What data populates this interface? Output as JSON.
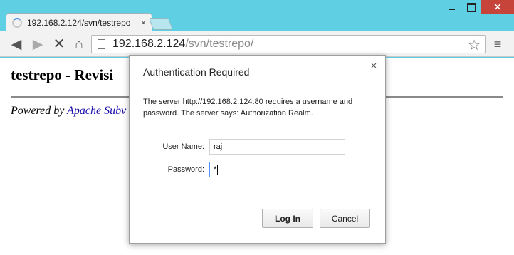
{
  "window": {
    "minimize_label": "",
    "maximize_label": "",
    "close_label": "✕"
  },
  "tab": {
    "title": "192.168.2.124/svn/testrepo",
    "close_label": "×"
  },
  "toolbar": {
    "back_icon": "◀",
    "forward_icon": "▶",
    "stop_icon": "✕",
    "home_icon": "⌂",
    "menu_icon": "≡",
    "url_host": "192.168.2.124",
    "url_path": "/svn/testrepo/",
    "bookmark_icon": "☆"
  },
  "page": {
    "heading": "testrepo - Revisi",
    "powered_prefix": "Powered by ",
    "powered_link": "Apache Subv"
  },
  "dialog": {
    "title": "Authentication Required",
    "close_label": "×",
    "message": "The server http://192.168.2.124:80 requires a username and password. The server says: Authorization Realm.",
    "username_label": "User Name:",
    "username_value": "raj",
    "password_label": "Password:",
    "password_value": "*",
    "login_label": "Log In",
    "cancel_label": "Cancel"
  },
  "colors": {
    "frame": "#5fd0e4",
    "close_button": "#c7443a",
    "link": "#1a0dab",
    "focus_border": "#4d90fe"
  }
}
